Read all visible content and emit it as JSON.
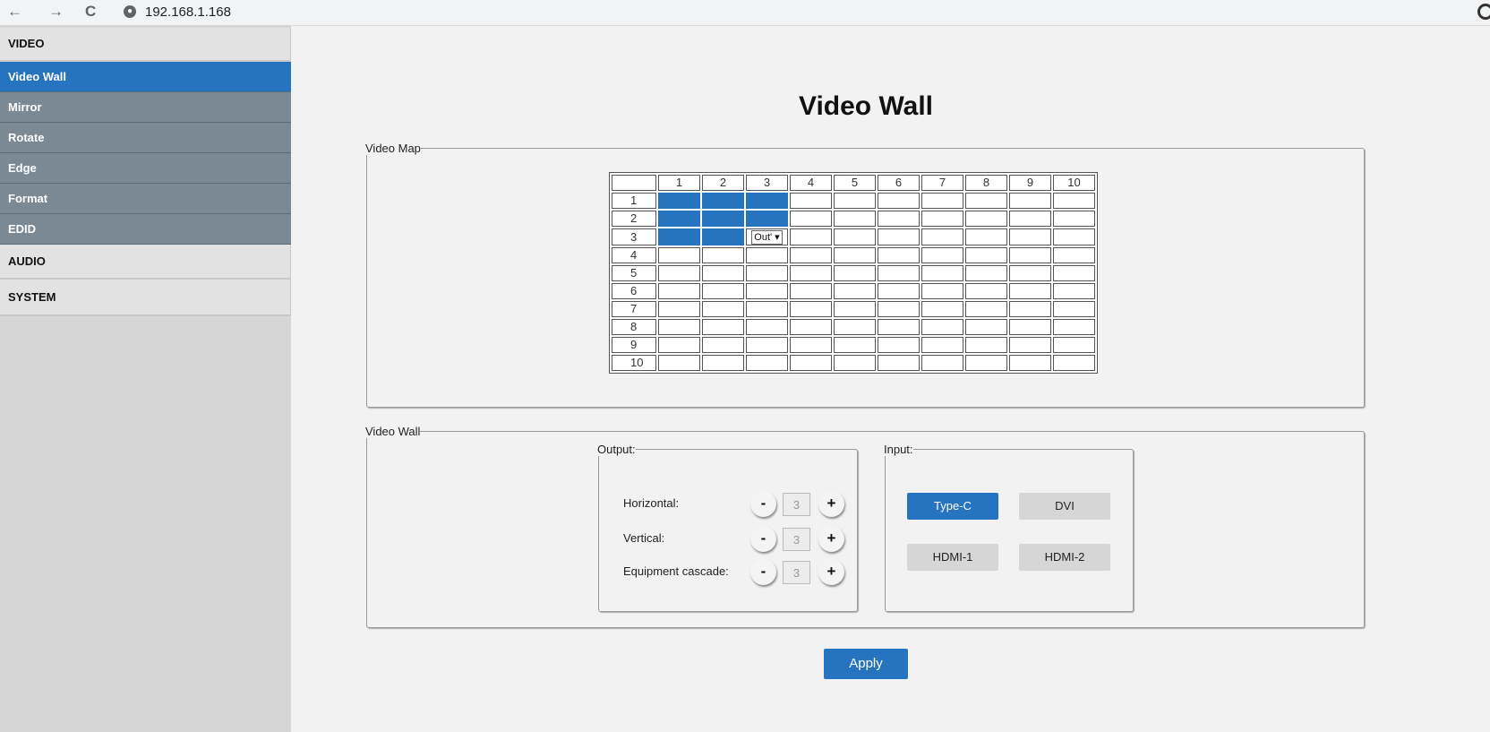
{
  "browser": {
    "back": "←",
    "forward": "→",
    "reload": "C",
    "url": "192.168.1.168"
  },
  "sidebar": {
    "video": "VIDEO",
    "items": [
      {
        "label": "Video Wall",
        "active": true
      },
      {
        "label": "Mirror"
      },
      {
        "label": "Rotate"
      },
      {
        "label": "Edge"
      },
      {
        "label": "Format"
      },
      {
        "label": "EDID"
      }
    ],
    "audio": "AUDIO",
    "system": "SYSTEM"
  },
  "page": {
    "title": "Video Wall"
  },
  "video_map": {
    "legend": "Video Map",
    "columns": [
      "1",
      "2",
      "3",
      "4",
      "5",
      "6",
      "7",
      "8",
      "9",
      "10"
    ],
    "rows": [
      "1",
      "2",
      "3",
      "4",
      "5",
      "6",
      "7",
      "8",
      "9",
      "10"
    ],
    "selected_cells": [
      [
        1,
        1
      ],
      [
        1,
        2
      ],
      [
        1,
        3
      ],
      [
        2,
        1
      ],
      [
        2,
        2
      ],
      [
        2,
        3
      ],
      [
        3,
        1
      ],
      [
        3,
        2
      ]
    ],
    "dropdown_cell": {
      "row": 3,
      "col": 3,
      "value": "Out'"
    }
  },
  "video_wall": {
    "legend": "Video Wall",
    "output": {
      "legend": "Output:",
      "horizontal": {
        "label": "Horizontal:",
        "value": "3"
      },
      "vertical": {
        "label": "Vertical:",
        "value": "3"
      },
      "cascade": {
        "label": "Equipment cascade:",
        "value": "3"
      },
      "minus": "-",
      "plus": "+"
    },
    "input": {
      "legend": "Input:",
      "sources": [
        {
          "label": "Type-C",
          "selected": true
        },
        {
          "label": "DVI",
          "selected": false
        },
        {
          "label": "HDMI-1",
          "selected": false
        },
        {
          "label": "HDMI-2",
          "selected": false
        }
      ]
    }
  },
  "apply_label": "Apply",
  "colors": {
    "accent": "#2673c0",
    "sidebar_sub": "#7a8994",
    "sidebar_bg": "#d6d6d6"
  }
}
